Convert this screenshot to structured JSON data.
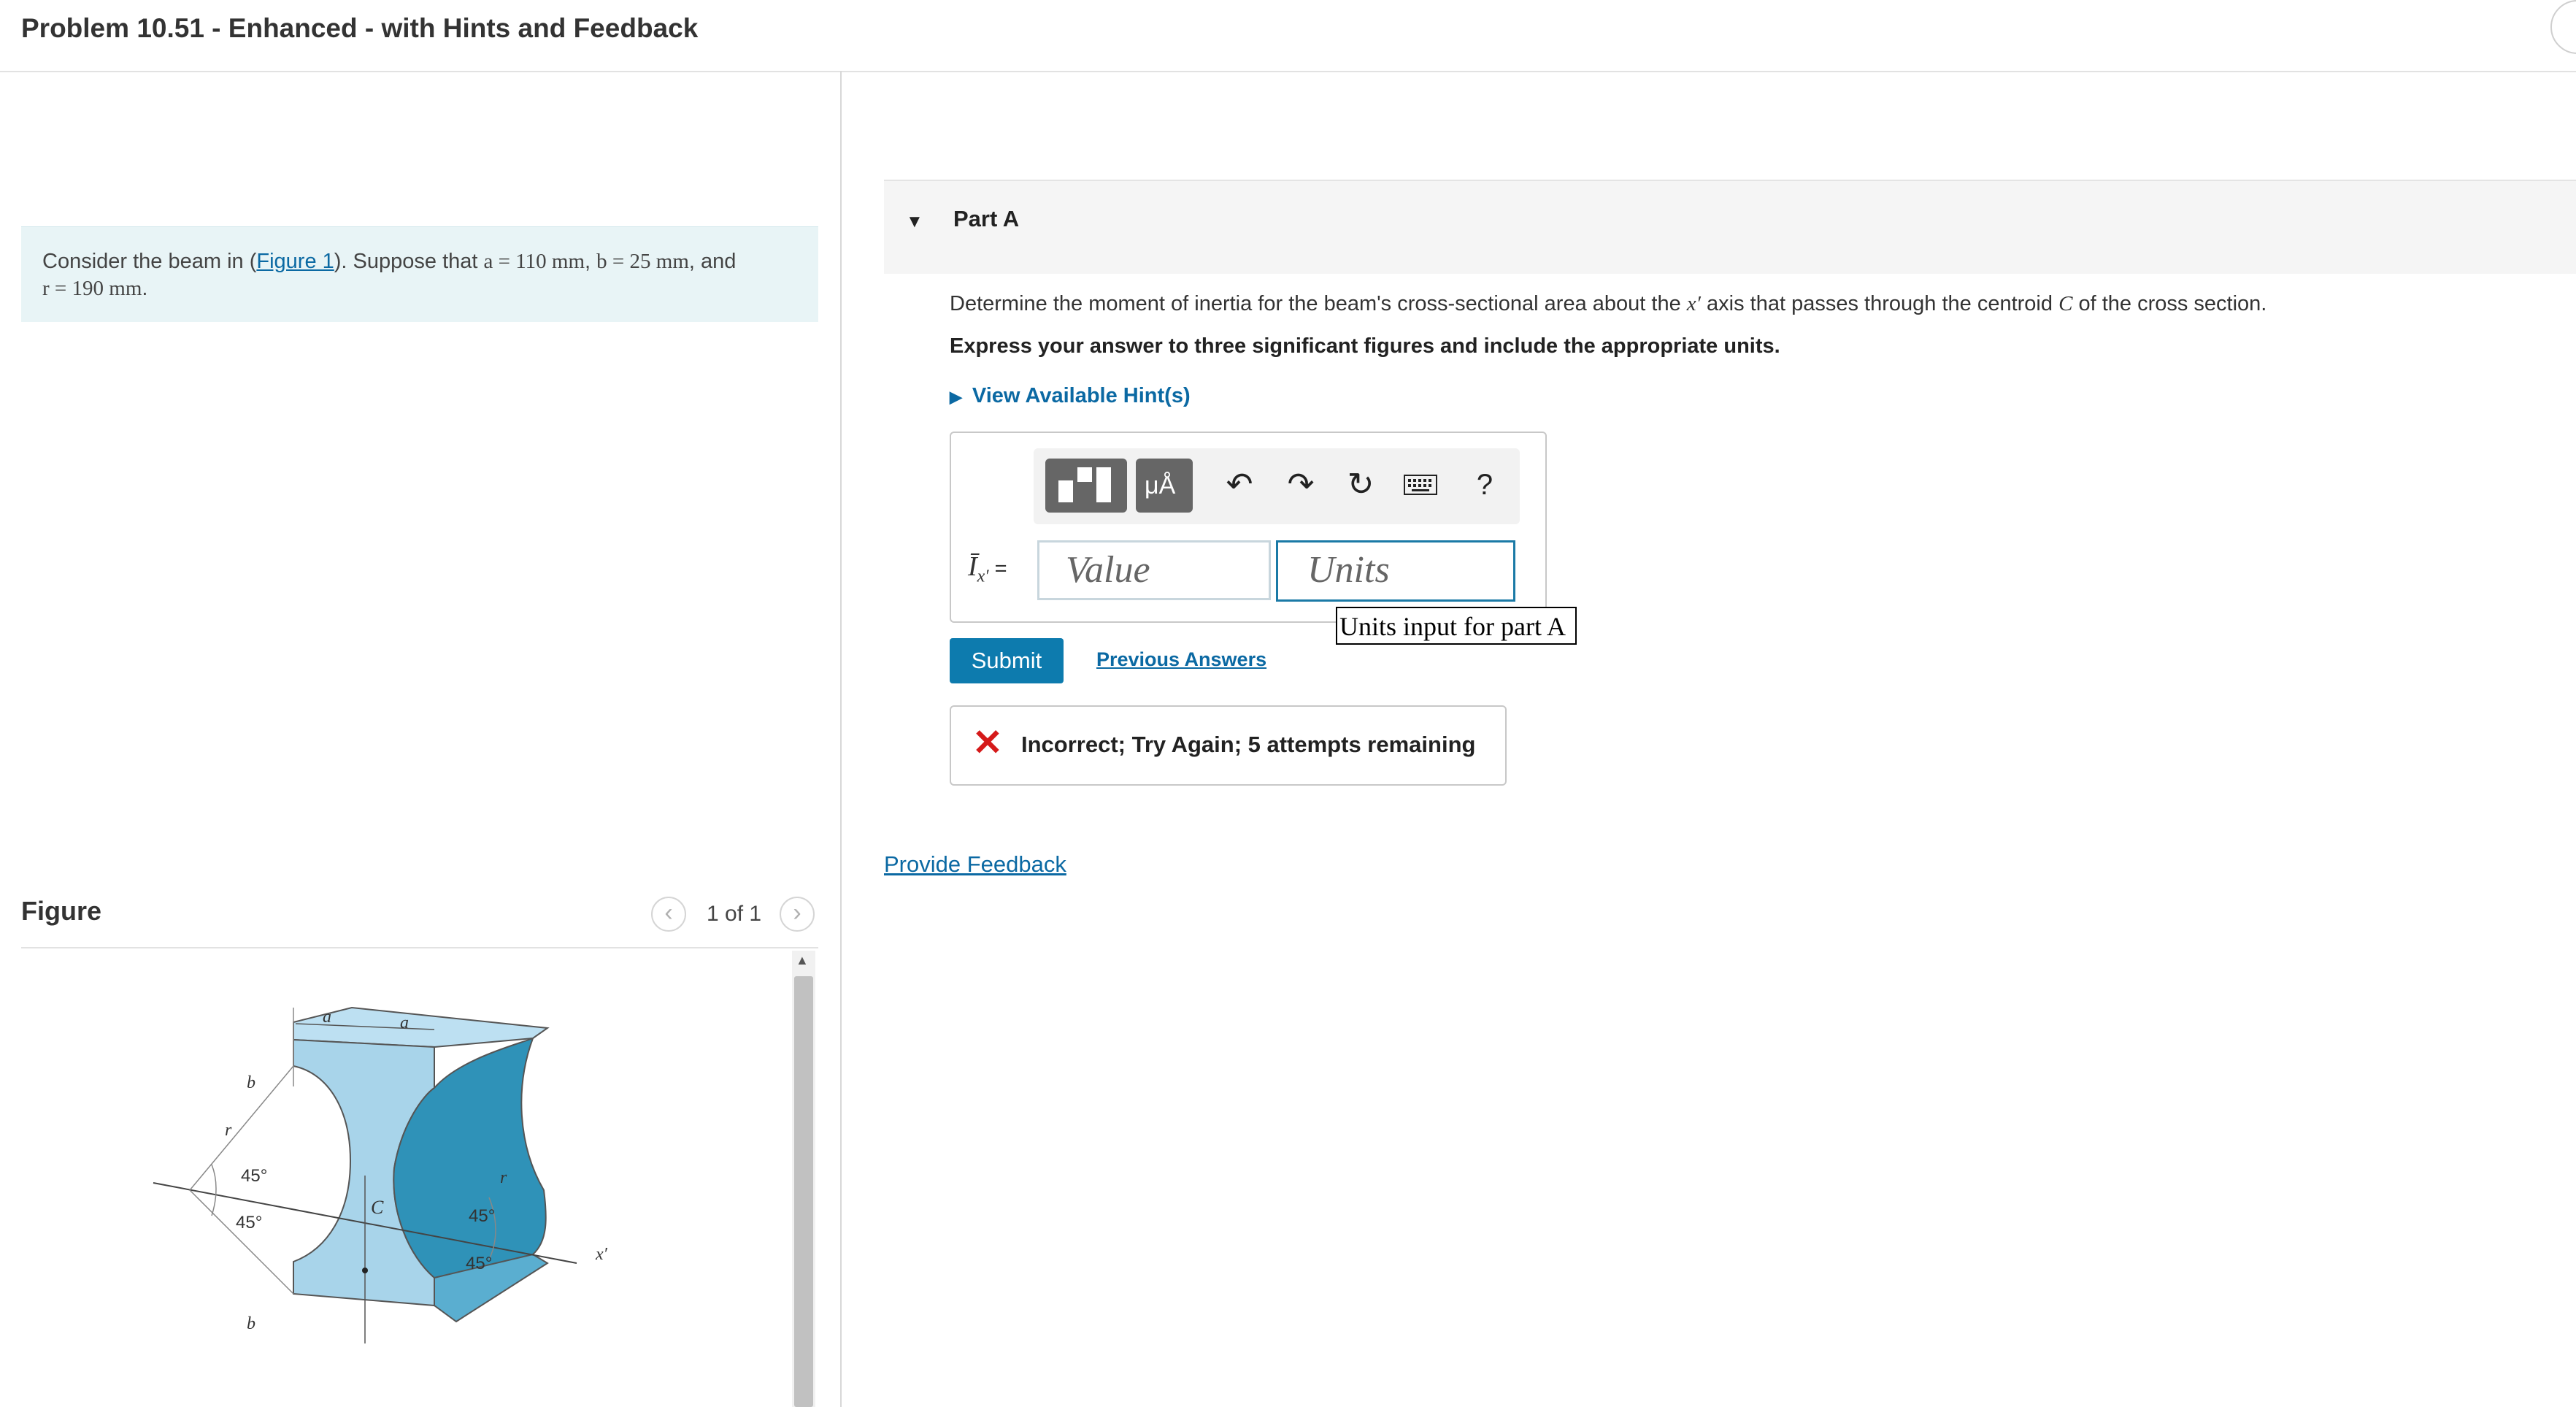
{
  "header": {
    "title": "Problem 10.51 - Enhanced - with Hints and Feedback"
  },
  "intro": {
    "p1": "Consider the beam in (",
    "figure_link": "Figure 1",
    "p2": "). Suppose that ",
    "a_eq": "a = 110 mm",
    "sep1": ", ",
    "b_eq": "b = 25 mm",
    "sep2": ", and",
    "r_eq": "r = 190 mm",
    "end": "."
  },
  "figure": {
    "title": "Figure",
    "pager": "1 of 1",
    "prev_icon": "chevron-left-icon",
    "next_icon": "chevron-right-icon",
    "labels": {
      "a1": "a",
      "a2": "a",
      "b_top": "b",
      "b_bottom": "b",
      "r_left": "r",
      "r_right": "r",
      "angle1": "45°",
      "angle2": "45°",
      "angle3": "45°",
      "angle4": "45°",
      "centroid": "C",
      "axis": "x′"
    }
  },
  "part": {
    "label": "Part A",
    "question_pre": "Determine the moment of inertia for the beam's cross-sectional area about the ",
    "question_axis": "x′",
    "question_mid": " axis that passes through the centroid ",
    "question_c": "C",
    "question_post": " of the cross section.",
    "instruction": "Express your answer to three significant figures and include the appropriate units.",
    "hint_label": "View Available Hint(s)"
  },
  "answer": {
    "lhs_symbol": "Ī",
    "lhs_sub": "x′",
    "lhs_eq": " =",
    "value_placeholder": "Value",
    "units_placeholder": "Units",
    "units_tooltip": "Units input for part A",
    "template_units_label": "μÅ",
    "toolbar_icons": [
      "templates-icon",
      "units-template-icon",
      "undo-icon",
      "redo-icon",
      "reset-icon",
      "keyboard-icon",
      "help-icon"
    ],
    "help_label": "?",
    "submit_label": "Submit",
    "previous_label": "Previous Answers"
  },
  "feedback": {
    "message": "Incorrect; Try Again; 5 attempts remaining"
  },
  "provide_feedback": "Provide Feedback",
  "colors": {
    "accent": "#0d7bae",
    "link": "#0b69a3",
    "error": "#d51a1a",
    "intro_bg": "#e8f4f6",
    "beam_light": "#a8d4ea",
    "beam_dark": "#2f92b8"
  }
}
